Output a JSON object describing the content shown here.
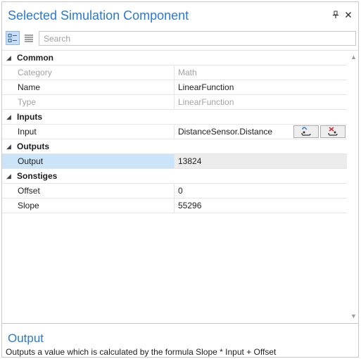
{
  "panel": {
    "title": "Selected Simulation Component",
    "pin_icon": "pin-icon",
    "close_icon": "close-icon"
  },
  "toolbar": {
    "categorized_icon": "categorized-view-icon",
    "alphabetical_icon": "alphabetical-view-icon",
    "search_placeholder": "Search"
  },
  "groups": {
    "common": "Common",
    "inputs": "Inputs",
    "outputs": "Outputs",
    "sonstiges": "Sonstiges"
  },
  "properties": {
    "category": {
      "name": "Category",
      "value": "Math"
    },
    "name": {
      "name": "Name",
      "value": "LinearFunction"
    },
    "type": {
      "name": "Type",
      "value": "LinearFunction"
    },
    "input": {
      "name": "Input",
      "value": "DistanceSensor.Distance"
    },
    "output": {
      "name": "Output",
      "value": "13824"
    },
    "offset": {
      "name": "Offset",
      "value": "0"
    },
    "slope": {
      "name": "Slope",
      "value": "55296"
    }
  },
  "input_buttons": {
    "connect_icon": "connect-icon",
    "disconnect_icon": "disconnect-icon"
  },
  "description": {
    "title": "Output",
    "text": "Outputs a value which is calculated by the formula Slope * Input + Offset"
  },
  "colors": {
    "accent": "#2b79d1",
    "selected_row": "#cce4f7"
  }
}
